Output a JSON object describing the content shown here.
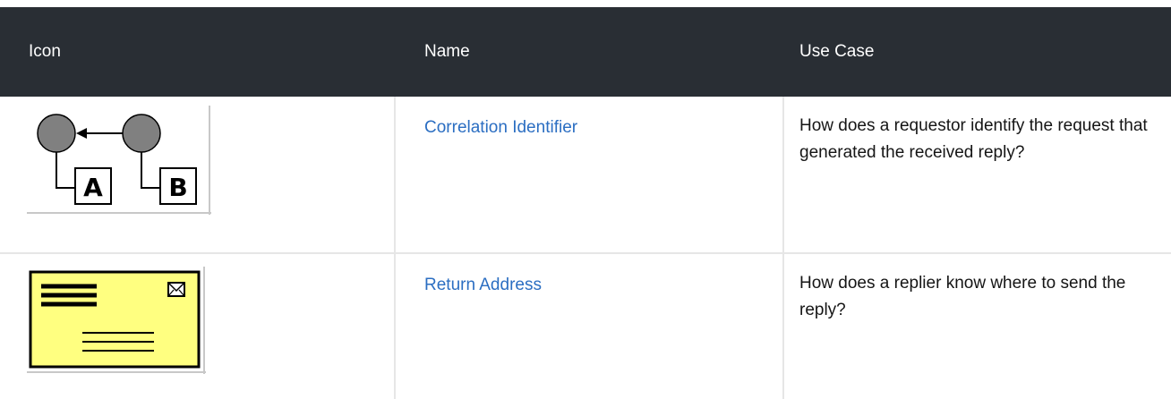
{
  "table": {
    "headers": [
      "Icon",
      "Name",
      "Use Case"
    ],
    "rows": [
      {
        "icon": "correlation-identifier-icon",
        "icon_letters": [
          "A",
          "B"
        ],
        "name": "Correlation Identifier",
        "use_case": "How does a requestor identify the request that generated the received reply?"
      },
      {
        "icon": "return-address-icon",
        "name": "Return Address",
        "use_case": "How does a replier know where to send the reply?"
      }
    ]
  },
  "colors": {
    "header_bg": "#292e34",
    "header_text": "#ffffff",
    "link": "#2b6ec2",
    "envelope_fill": "#ffff80",
    "border": "#e6e6e6"
  }
}
